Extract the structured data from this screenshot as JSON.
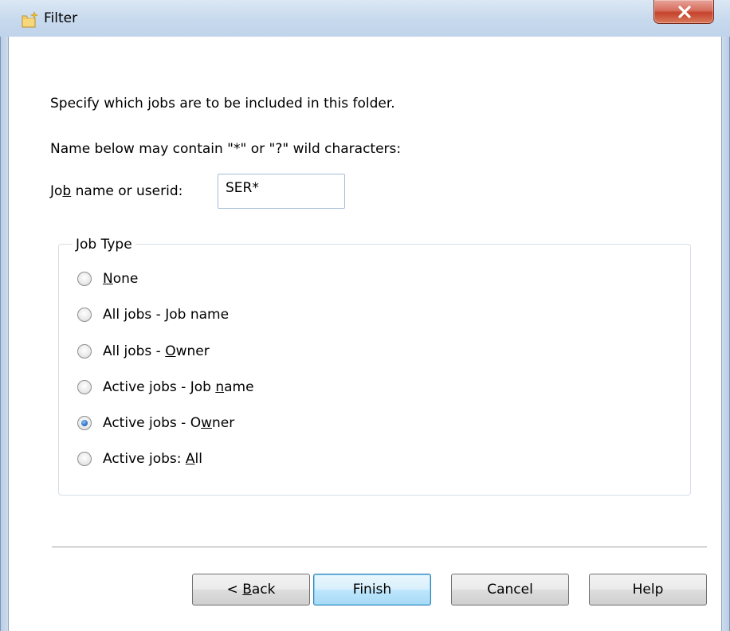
{
  "window": {
    "title": "Filter"
  },
  "description": "Specify which jobs are to be included in this folder.",
  "hint": "Name below may contain \"*\" or \"?\" wild characters:",
  "job_field": {
    "label_pre": "Jo",
    "label_mnemonic": "b",
    "label_post": " name or userid:",
    "value": "SER*"
  },
  "job_type": {
    "legend": "Job Type",
    "options": [
      {
        "pre": "",
        "mnemonic": "N",
        "post": "one",
        "checked": false
      },
      {
        "pre": "All jobs - ",
        "mnemonic": "J",
        "post": "ob name",
        "checked": false
      },
      {
        "pre": "All jobs - ",
        "mnemonic": "O",
        "post": "wner",
        "checked": false
      },
      {
        "pre": "Active jobs - Job ",
        "mnemonic": "n",
        "post": "ame",
        "checked": false
      },
      {
        "pre": "Active jobs - O",
        "mnemonic": "w",
        "post": "ner",
        "checked": true
      },
      {
        "pre": "Active jobs: ",
        "mnemonic": "A",
        "post": "ll",
        "checked": false
      }
    ]
  },
  "buttons": {
    "back_pre": "< ",
    "back_mnemonic": "B",
    "back_post": "ack",
    "finish": "Finish",
    "cancel": "Cancel",
    "help": "Help"
  },
  "icons": {
    "title": "new-folder-icon",
    "close": "close-icon"
  }
}
